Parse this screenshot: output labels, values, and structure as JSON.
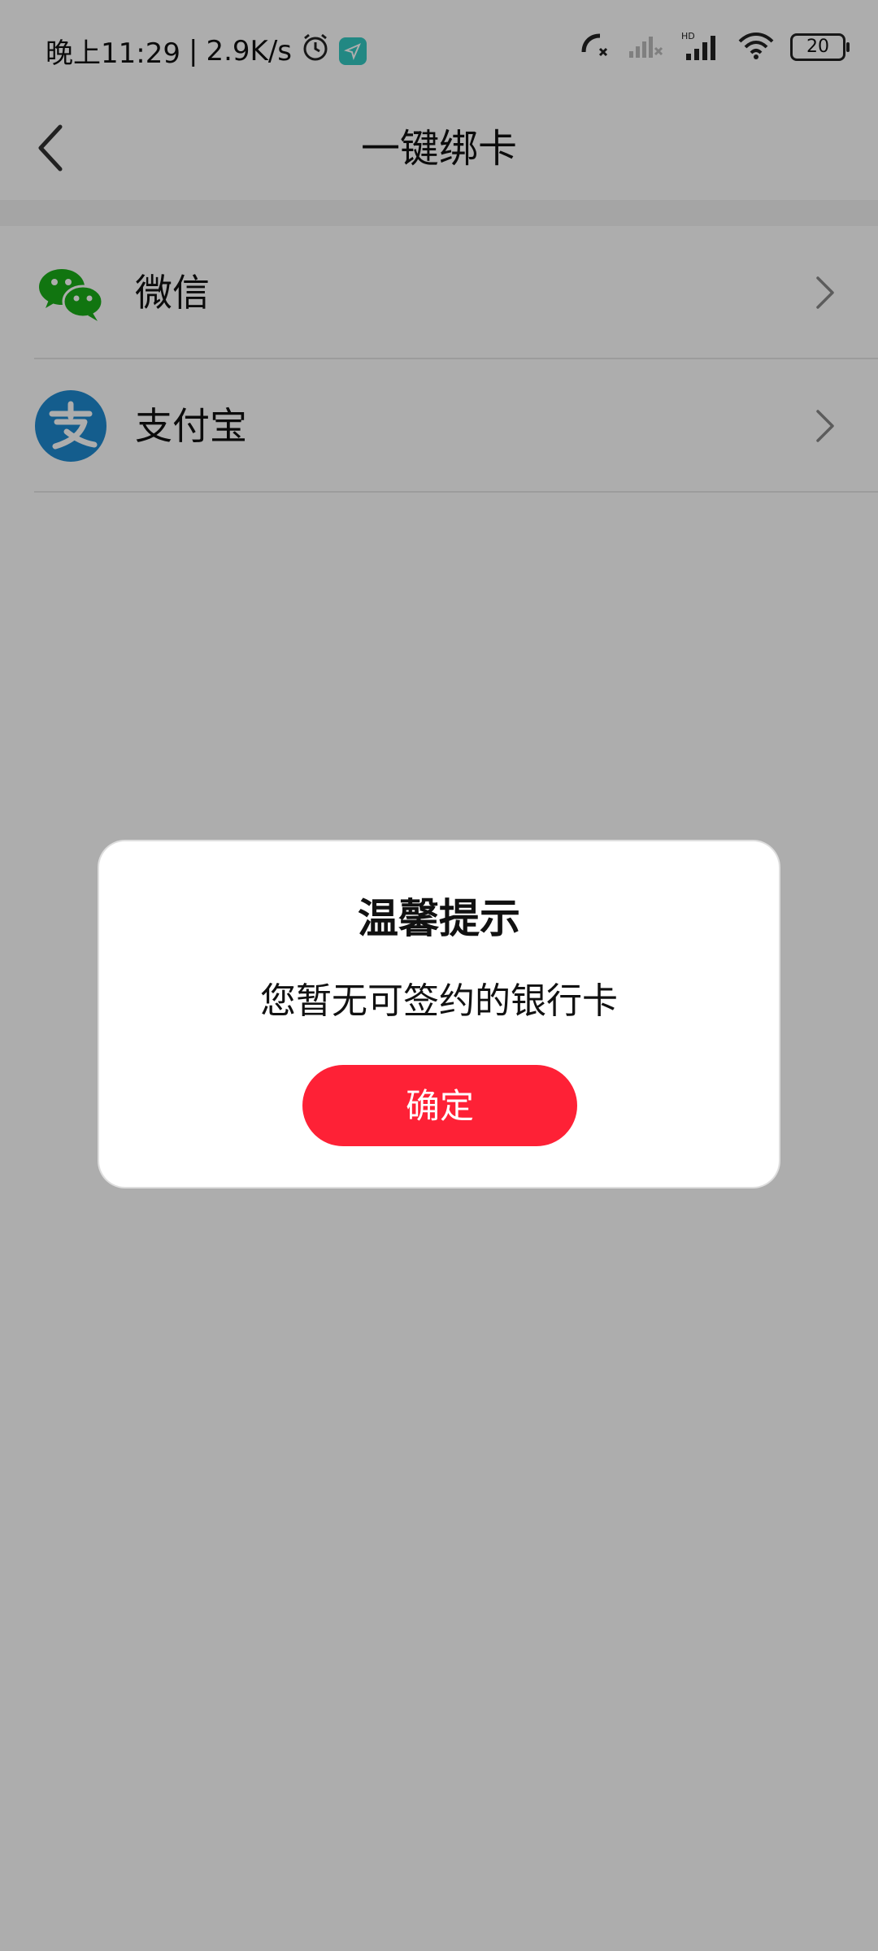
{
  "status_bar": {
    "time": "晚上11:29",
    "separator": "|",
    "speed": "2.9K/s",
    "battery": "20",
    "icons": [
      "alarm-icon",
      "navigation-icon",
      "call-forward-icon",
      "signal-off-icon",
      "hd-signal-icon",
      "wifi-icon",
      "battery-icon"
    ]
  },
  "header": {
    "title": "一键绑卡"
  },
  "list": {
    "items": [
      {
        "label": "微信",
        "icon": "wechat-icon"
      },
      {
        "label": "支付宝",
        "icon": "alipay-icon"
      }
    ]
  },
  "dialog": {
    "title": "温馨提示",
    "message": "您暂无可签约的银行卡",
    "confirm_label": "确定"
  },
  "colors": {
    "accent": "#fe2136",
    "wechat_green": "#1aad19",
    "alipay_blue": "#1e89d0",
    "nav_teal": "#33c9c2"
  }
}
